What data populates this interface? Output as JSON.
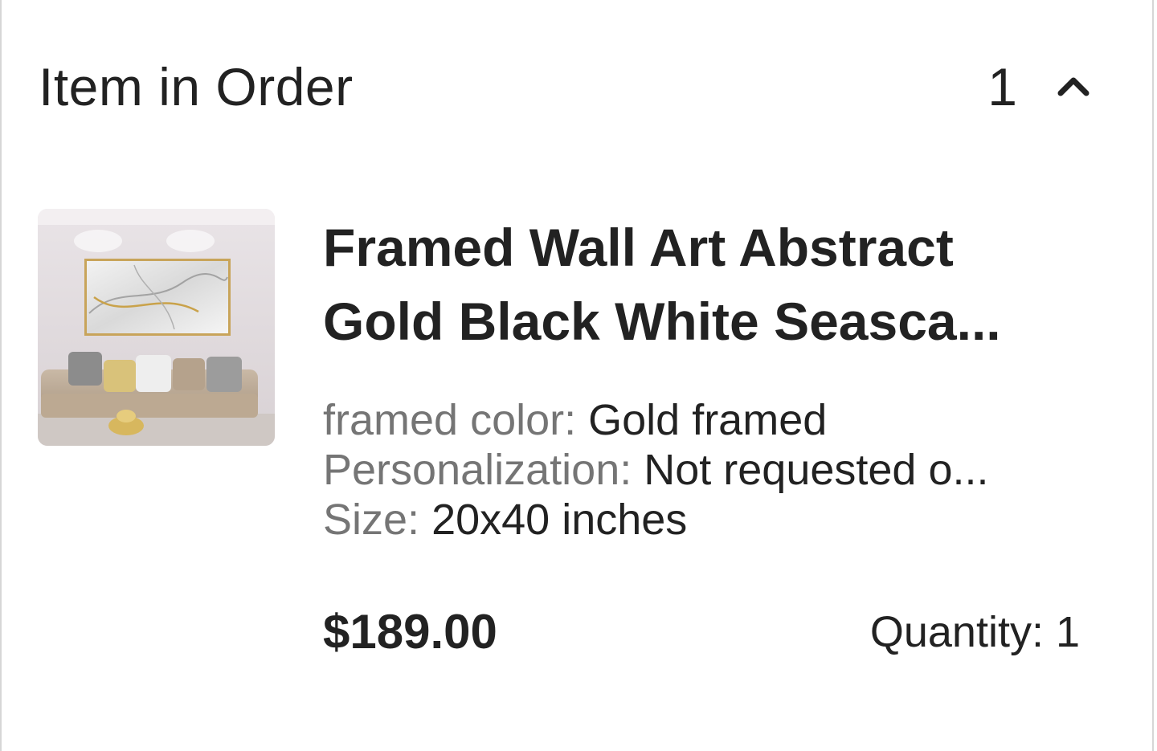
{
  "section": {
    "title": "Item in Order",
    "item_count": "1",
    "toggle_icon": "chevron-up-icon"
  },
  "item": {
    "title_line1": "Framed Wall Art Abstract",
    "title_line2": "Gold Black White Seasca...",
    "attributes": [
      {
        "label": "framed color: ",
        "value": "Gold framed"
      },
      {
        "label": "Personalization: ",
        "value": "Not requested o..."
      },
      {
        "label": "Size: ",
        "value": "20x40 inches"
      }
    ],
    "price": "$189.00",
    "quantity_label": "Quantity: 1"
  },
  "colors": {
    "text_primary": "#222222",
    "text_secondary": "#757575",
    "border": "#d6d6d6"
  }
}
